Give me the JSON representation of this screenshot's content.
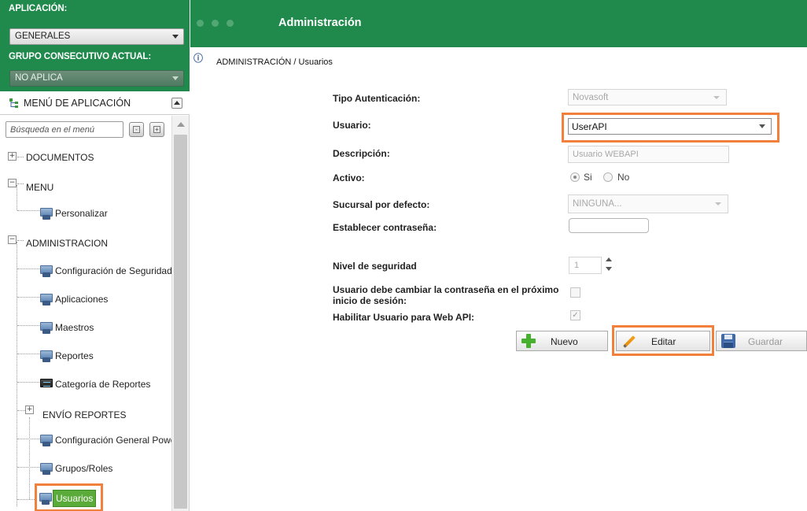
{
  "sidebar": {
    "app_label": "APLICACIÓN:",
    "app_value": "GENERALES",
    "group_label": "GRUPO CONSECUTIVO ACTUAL:",
    "group_value": "NO APLICA",
    "menu_title": "MENÚ DE APLICACIÓN",
    "search_placeholder": "Búsqueda en el menú",
    "tree": {
      "documentos": "DOCUMENTOS",
      "menu": "MENU",
      "personalizar": "Personalizar",
      "administracion": "ADMINISTRACION",
      "config_seguridad": "Configuración de Seguridad",
      "aplicaciones": "Aplicaciones",
      "maestros": "Maestros",
      "reportes": "Reportes",
      "categoria_reportes": "Categoría de Reportes",
      "envio_reportes": "ENVÍO REPORTES",
      "config_power": "Configuración General Power BI",
      "grupos_roles": "Grupos/Roles",
      "usuarios": "Usuarios"
    }
  },
  "header": {
    "title": "Administración",
    "breadcrumb": "ADMINISTRACIÓN / Usuarios"
  },
  "form": {
    "tipo_auth_label": "Tipo Autenticación:",
    "tipo_auth_value": "Novasoft",
    "usuario_label": "Usuario:",
    "usuario_value": "UserAPI",
    "descripcion_label": "Descripción:",
    "descripcion_value": "Usuario WEBAPI",
    "activo_label": "Activo:",
    "activo_si": "Si",
    "activo_no": "No",
    "sucursal_label": "Sucursal por defecto:",
    "sucursal_value": "NINGUNA...",
    "contrasena_label": "Establecer contraseña:",
    "nivel_label": "Nivel de seguridad",
    "nivel_value": "1",
    "cambiar_label_1": "Usuario debe cambiar la contraseña en el próximo",
    "cambiar_label_2": "inicio de sesión:",
    "webapi_label": "Habilitar Usuario para Web API:"
  },
  "buttons": {
    "nuevo": "Nuevo",
    "editar": "Editar",
    "guardar": "Guardar"
  },
  "colors": {
    "brand_green": "#1f8a4c",
    "highlight_orange": "#f0803c",
    "selected_green": "#5bab3a"
  }
}
